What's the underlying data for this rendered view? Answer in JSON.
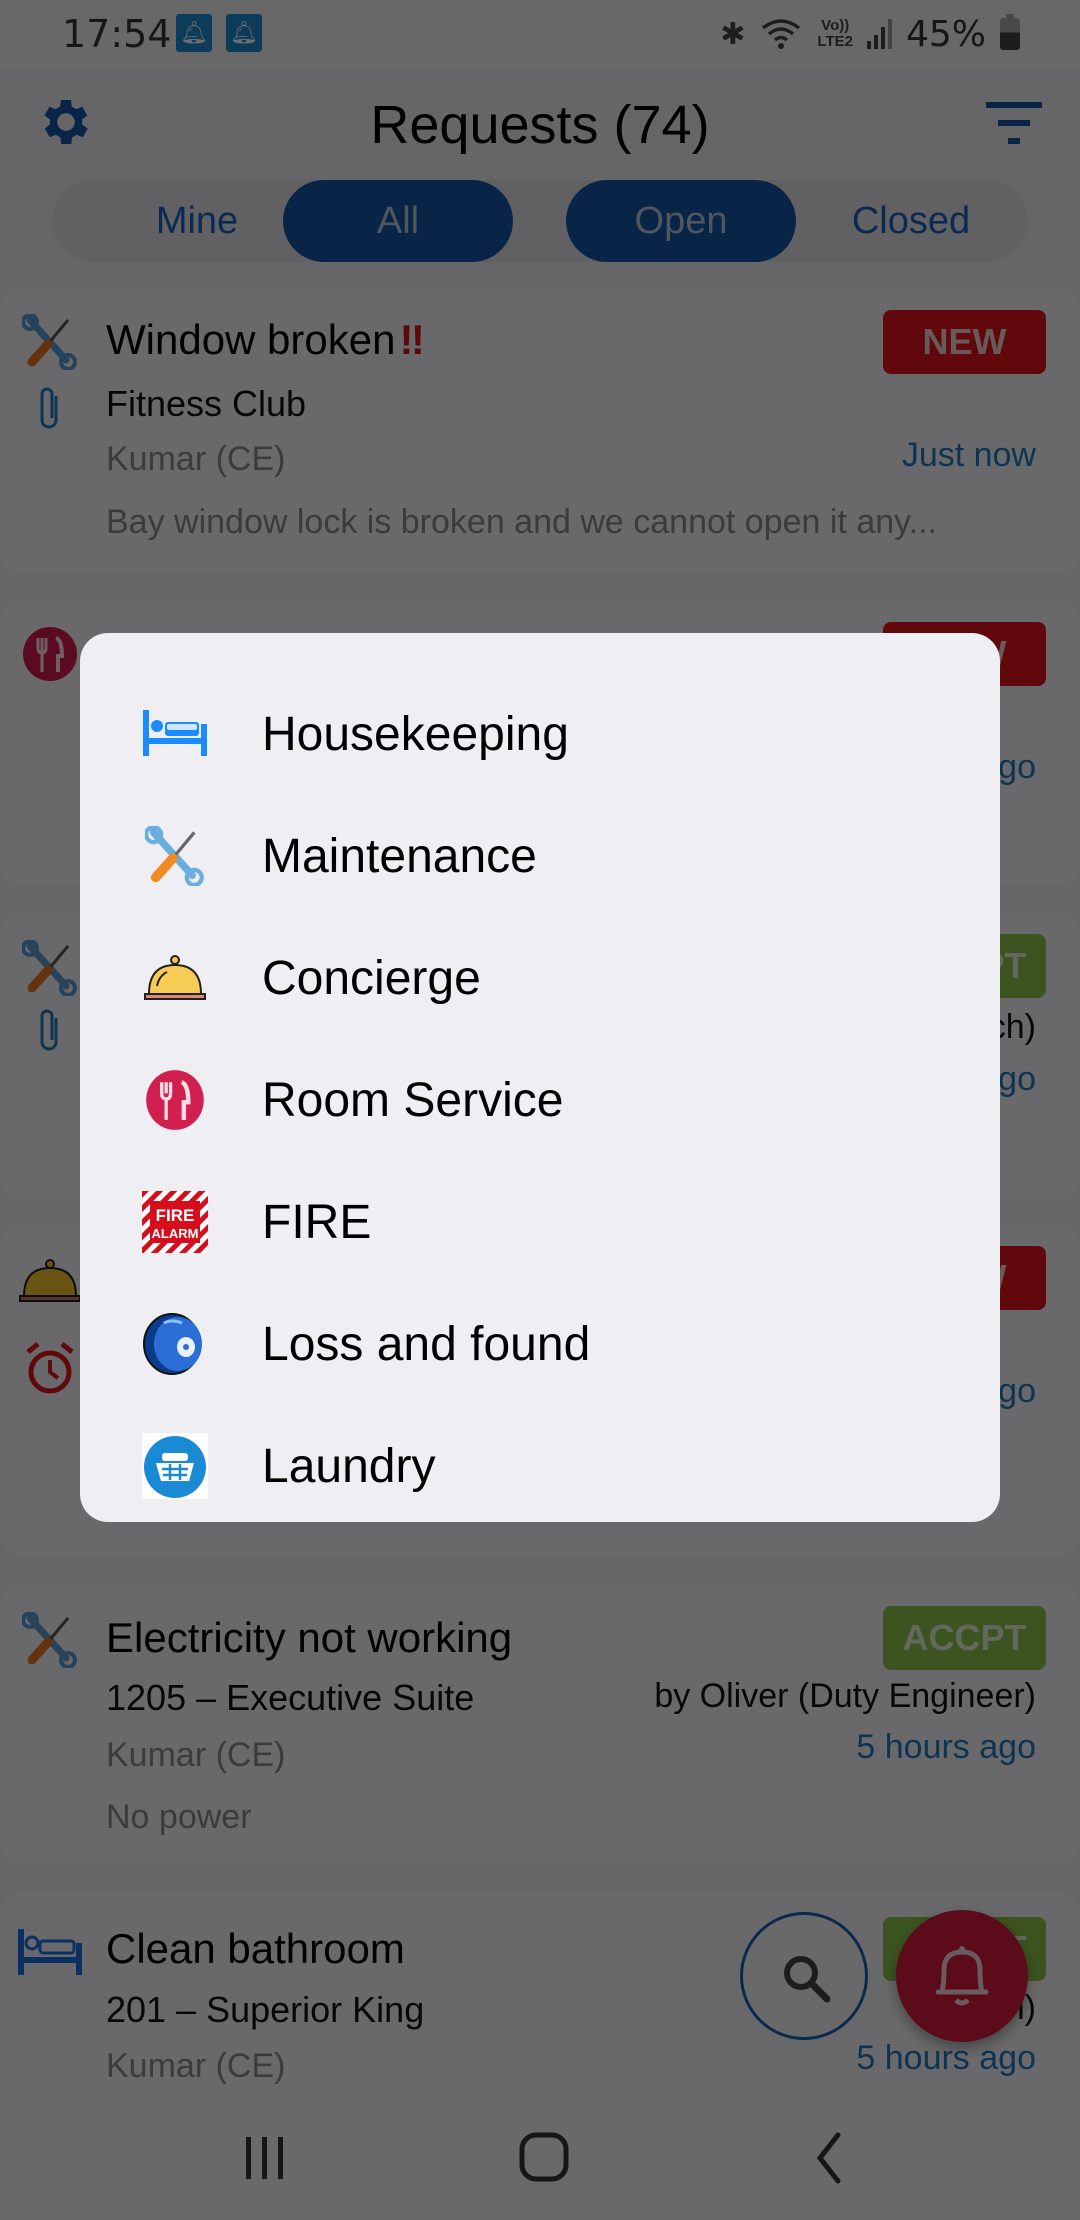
{
  "status_bar": {
    "time": "17:54",
    "notification_icons": [
      "alarm-bell",
      "alarm-bell"
    ],
    "network": "LTE2",
    "volte": "Vo))",
    "battery_percent": "45%"
  },
  "header": {
    "title": "Requests (74)",
    "settings_icon": "gear-icon",
    "filter_icon": "filter-icon"
  },
  "segments": {
    "owner": [
      {
        "label": "Mine",
        "active": false
      },
      {
        "label": "All",
        "active": true
      }
    ],
    "state": [
      {
        "label": "Open",
        "active": true
      },
      {
        "label": "Closed",
        "active": false
      }
    ]
  },
  "requests": [
    {
      "category_icon": "maintenance-icon",
      "has_attachment": true,
      "title": "Window broken",
      "priority_mark": "‼",
      "location": "Fitness Club",
      "author": "Kumar (CE)",
      "description": "Bay window lock is broken and we cannot open it any...",
      "badge": "NEW",
      "time": "Just now"
    },
    {
      "category_icon": "room-service-icon",
      "badge": "NEW",
      "time_partial": "go"
    },
    {
      "category_icon": "maintenance-icon",
      "has_attachment": true,
      "badge": "ACCPT",
      "by_partial": "ch)",
      "time_partial": "go"
    },
    {
      "category_icon": "concierge-icon",
      "secondary_icon": "alarm-clock-icon",
      "badge": "NEW",
      "time_partial": "go"
    },
    {
      "category_icon": "maintenance-icon",
      "title": "Electricity not working",
      "location": "1205 – Executive Suite",
      "author": "Kumar (CE)",
      "description": "No power",
      "badge": "ACCPT",
      "accepted_by": "by Oliver (Duty Engineer)",
      "time": "5 hours ago"
    },
    {
      "category_icon": "housekeeping-icon",
      "title": "Clean bathroom",
      "location": "201 – Superior King",
      "author": "Kumar (CE)",
      "badge": "ACCPT",
      "accepted_by_partial": "Ma… l)",
      "time": "5 hours ago"
    }
  ],
  "fabs": {
    "search": "search-icon",
    "new_request": "bell-icon"
  },
  "dialog": {
    "items": [
      {
        "label": "Housekeeping",
        "icon": "housekeeping-icon"
      },
      {
        "label": "Maintenance",
        "icon": "maintenance-icon"
      },
      {
        "label": "Concierge",
        "icon": "concierge-icon"
      },
      {
        "label": "Room Service",
        "icon": "room-service-icon"
      },
      {
        "label": "FIRE",
        "icon": "fire-alarm-icon",
        "icon_text": [
          "FIRE",
          "ALARM"
        ]
      },
      {
        "label": "Loss and found",
        "icon": "lost-found-icon"
      },
      {
        "label": "Laundry",
        "icon": "laundry-icon"
      }
    ]
  },
  "colors": {
    "primary": "#1454a6",
    "badge_new": "#e0141e",
    "badge_accepted": "#8bc34a",
    "time_link": "#1f7bbf",
    "fab_bell": "#d41a3c"
  }
}
